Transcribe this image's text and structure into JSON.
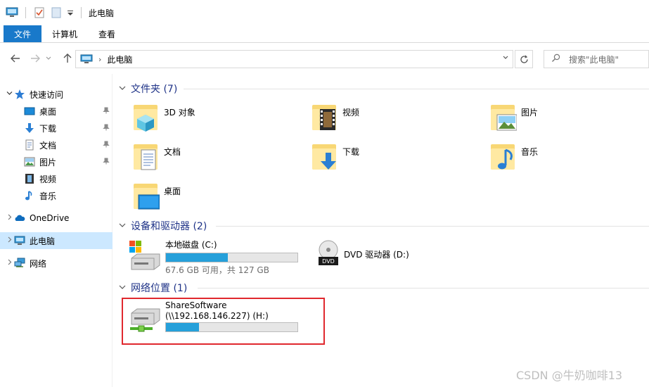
{
  "window": {
    "title": "此电脑"
  },
  "ribbon": {
    "tabs": [
      "文件",
      "计算机",
      "查看"
    ]
  },
  "address": {
    "crumb": "此电脑",
    "search_placeholder": "搜索\"此电脑\""
  },
  "sidebar": {
    "items": [
      {
        "label": "快速访问",
        "icon": "star-icon"
      },
      {
        "label": "桌面",
        "icon": "desktop-icon",
        "pinned": true
      },
      {
        "label": "下载",
        "icon": "download-icon",
        "pinned": true
      },
      {
        "label": "文档",
        "icon": "document-icon",
        "pinned": true
      },
      {
        "label": "图片",
        "icon": "picture-icon",
        "pinned": true
      },
      {
        "label": "视频",
        "icon": "video-icon"
      },
      {
        "label": "音乐",
        "icon": "music-icon"
      },
      {
        "label": "OneDrive",
        "icon": "cloud-icon"
      },
      {
        "label": "此电脑",
        "icon": "computer-icon"
      },
      {
        "label": "网络",
        "icon": "network-icon"
      }
    ]
  },
  "groups": {
    "folders": {
      "title": "文件夹 (7)"
    },
    "devices": {
      "title": "设备和驱动器 (2)"
    },
    "network": {
      "title": "网络位置 (1)"
    }
  },
  "folders": [
    {
      "label": "3D 对象",
      "icon": "3d-objects-icon"
    },
    {
      "label": "视频",
      "icon": "video-folder-icon"
    },
    {
      "label": "图片",
      "icon": "pictures-folder-icon"
    },
    {
      "label": "文档",
      "icon": "documents-folder-icon"
    },
    {
      "label": "下载",
      "icon": "downloads-folder-icon"
    },
    {
      "label": "音乐",
      "icon": "music-folder-icon"
    },
    {
      "label": "桌面",
      "icon": "desktop-folder-icon"
    }
  ],
  "drives": {
    "local": {
      "name": "本地磁盘 (C:)",
      "usage": "67.6 GB 可用，共 127 GB",
      "used_fraction": 0.468
    },
    "dvd": {
      "name": "DVD 驱动器 (D:)",
      "badge": "DVD"
    },
    "share": {
      "name": "ShareSoftware",
      "path": "(\\\\192.168.146.227) (H:)",
      "used_fraction": 0.25
    }
  },
  "watermark": "CSDN @牛奶咖啡13",
  "colors": {
    "accent": "#1979ca",
    "selection": "#cce8ff",
    "bar_fill": "#26a0da",
    "highlight_box": "#e0282e",
    "group_header": "#1e3287"
  }
}
